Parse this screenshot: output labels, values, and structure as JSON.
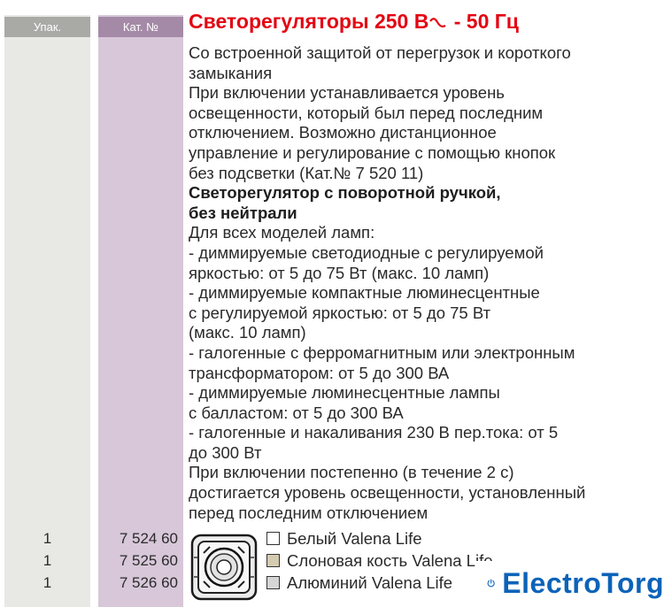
{
  "header": {
    "col_upak": "Упак.",
    "col_kat": "Кат. №",
    "title": "Светорегуляторы 250 В",
    "title_suffix": " - 50 Гц"
  },
  "description": [
    {
      "text": "Со встроенной защитой от перегрузок и короткого",
      "bold": false
    },
    {
      "text": "замыкания",
      "bold": false
    },
    {
      "text": "При включении устанавливается уровень",
      "bold": false
    },
    {
      "text": "освещенности, который был перед последним",
      "bold": false
    },
    {
      "text": "отключением. Возможно дистанционное",
      "bold": false
    },
    {
      "text": "управление и регулирование с помощью кнопок",
      "bold": false
    },
    {
      "text": "без подсветки (Кат.№ 7 520 11)",
      "bold": false
    },
    {
      "text": "Светорегулятор с поворотной ручкой,",
      "bold": true
    },
    {
      "text": "без нейтрали",
      "bold": true
    },
    {
      "text": "Для всех моделей ламп:",
      "bold": false
    },
    {
      "text": "- диммируемые светодиодные с регулируемой",
      "bold": false
    },
    {
      "text": "яркостью: от 5 до 75 Вт (макс. 10 ламп)",
      "bold": false
    },
    {
      "text": "- диммируемые компактные люминесцентные",
      "bold": false
    },
    {
      "text": "с регулируемой яркостью: от 5 до 75 Вт",
      "bold": false
    },
    {
      "text": "(макс. 10 ламп)",
      "bold": false
    },
    {
      "text": "- галогенные с ферромагнитным или электронным",
      "bold": false
    },
    {
      "text": "трансформатором: от 5 до 300 ВА",
      "bold": false
    },
    {
      "text": "- диммируемые люминесцентные лампы",
      "bold": false
    },
    {
      "text": "с балластом: от 5 до 300 ВА",
      "bold": false
    },
    {
      "text": "- галогенные и накаливания 230 В пер.тока: от 5",
      "bold": false
    },
    {
      "text": "до 300 Вт",
      "bold": false
    },
    {
      "text": "При включении постепенно (в течение 2 с)",
      "bold": false
    },
    {
      "text": "достигается уровень освещенности, установленный",
      "bold": false
    },
    {
      "text": "перед последним отключением",
      "bold": false
    }
  ],
  "variants": [
    {
      "qty": "1",
      "cat": "7 524 60",
      "name": "Белый Valena Life",
      "swatch": "#ffffff"
    },
    {
      "qty": "1",
      "cat": "7 525 60",
      "name": "Слоновая кость Valena Life",
      "swatch": "#d4cbb0"
    },
    {
      "qty": "1",
      "cat": "7 526 60",
      "name": "Алюминий Valena Life",
      "swatch": "#d6d6d6"
    }
  ],
  "watermark": {
    "text": "ElectroTorg",
    "color": "#0c63b8"
  },
  "colors": {
    "title": "#e30613",
    "col_upak": "#e8e8e4",
    "col_kat": "#d7c7d9"
  }
}
